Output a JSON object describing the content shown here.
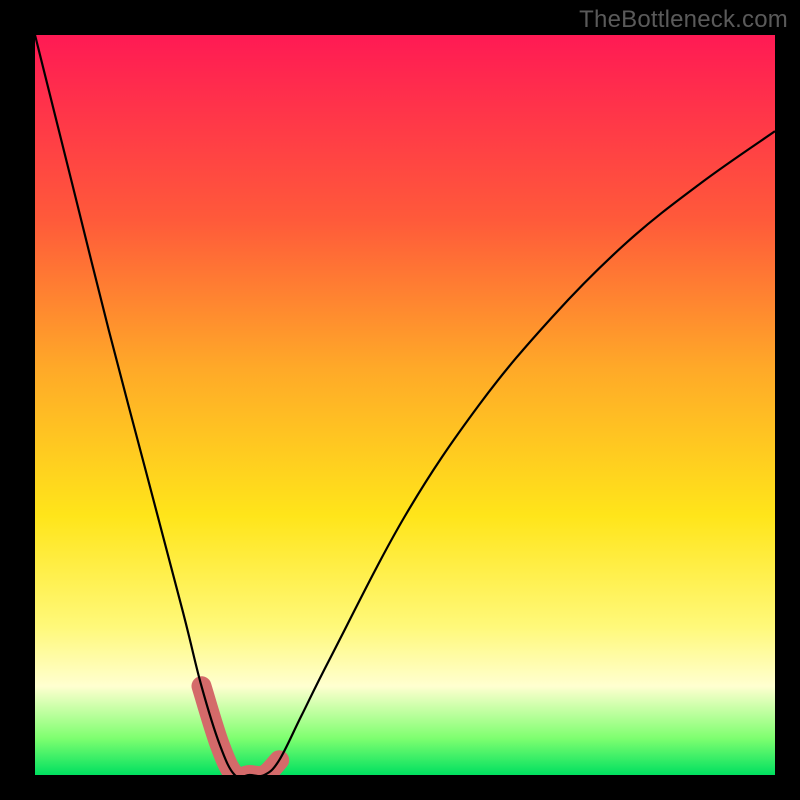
{
  "watermark": "TheBottleneck.com",
  "chart_data": {
    "type": "line",
    "title": "",
    "xlabel": "",
    "ylabel": "",
    "xlim": [
      0,
      100
    ],
    "ylim": [
      0,
      100
    ],
    "series": [
      {
        "name": "bottleneck-curve",
        "x": [
          0,
          5,
          10,
          15,
          20,
          22.5,
          25,
          27,
          29,
          31,
          33,
          36,
          40,
          50,
          60,
          70,
          80,
          90,
          100
        ],
        "values": [
          100,
          80,
          60,
          41,
          22,
          12,
          4,
          0,
          0,
          0,
          2,
          8,
          16,
          35,
          50,
          62,
          72,
          80,
          87
        ]
      }
    ],
    "highlight_band_x": [
      22.5,
      33
    ],
    "highlight_band_y_max": 12,
    "background_gradient": {
      "type": "vertical",
      "stops": [
        {
          "pos": 0,
          "color": "#ff1a54"
        },
        {
          "pos": 25,
          "color": "#ff5a3a"
        },
        {
          "pos": 45,
          "color": "#ffa928"
        },
        {
          "pos": 65,
          "color": "#ffe51a"
        },
        {
          "pos": 80,
          "color": "#fff97a"
        },
        {
          "pos": 88,
          "color": "#ffffd0"
        },
        {
          "pos": 95,
          "color": "#7fff70"
        },
        {
          "pos": 100,
          "color": "#00e060"
        }
      ]
    },
    "colors": {
      "curve": "#000000",
      "highlight": "#d46a6a",
      "frame": "#000000"
    }
  }
}
